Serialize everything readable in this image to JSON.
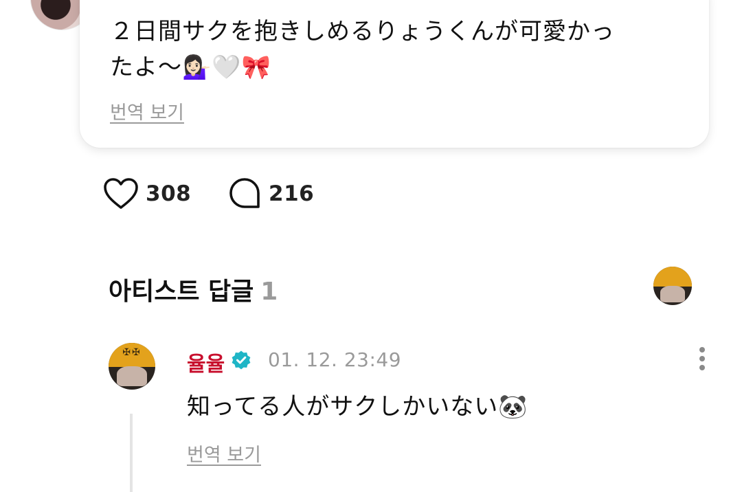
{
  "post": {
    "text_line1": "２日間サクを抱きしめるりょうくんが可愛かっ",
    "text_line2": "たよ〜💁🏻‍♀️🤍🎀",
    "translate_label": "번역 보기"
  },
  "reactions": {
    "like_count": "308",
    "comment_count": "216"
  },
  "artist_replies": {
    "title": "아티스트 답글",
    "count": "1"
  },
  "comment": {
    "author": "율율",
    "timestamp": "01. 12. 23:49",
    "text": "知ってる人がサクしかいない🐼",
    "translate_label": "번역 보기"
  },
  "icons": {
    "like": "heart-outline-icon",
    "comment": "speech-bubble-icon",
    "verified": "verified-badge-icon",
    "more": "more-vertical-icon"
  },
  "colors": {
    "author_name": "#c8102e",
    "verified_badge": "#1fb5c6",
    "muted_text": "#9a9a9a"
  }
}
